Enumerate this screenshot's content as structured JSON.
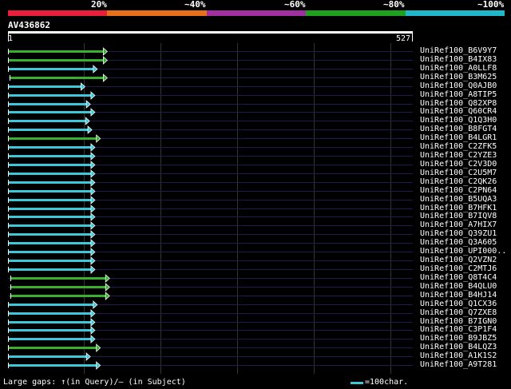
{
  "identity_scale": [
    {
      "label": "20%",
      "color": "#e8203a"
    },
    {
      "label": "~40%",
      "color": "#e8701a"
    },
    {
      "label": "~60%",
      "color": "#a030a0"
    },
    {
      "label": "~80%",
      "color": "#20a020"
    },
    {
      "label": "~100%",
      "color": "#20b8c8"
    }
  ],
  "query": {
    "id": "AV436862",
    "start": "1",
    "end": "527"
  },
  "colors": {
    "green": "#3ab030",
    "cyan": "#3cc8d8",
    "grid": "#333333",
    "row_line": "#1c1c50"
  },
  "hits": [
    {
      "id": "UniRef100_B6V9Y7",
      "color": "green",
      "start": 1,
      "end": 130
    },
    {
      "id": "UniRef100_B4IX83",
      "color": "green",
      "start": 1,
      "end": 130
    },
    {
      "id": "UniRef100_A0LLF8",
      "color": "cyan",
      "start": 1,
      "end": 117
    },
    {
      "id": "UniRef100_B3M625",
      "color": "green",
      "start": 3,
      "end": 130
    },
    {
      "id": "UniRef100_Q0AJB0",
      "color": "cyan",
      "start": 1,
      "end": 101
    },
    {
      "id": "UniRef100_A8TIP5",
      "color": "cyan",
      "start": 1,
      "end": 114
    },
    {
      "id": "UniRef100_Q82XP8",
      "color": "cyan",
      "start": 1,
      "end": 108
    },
    {
      "id": "UniRef100_Q60CR4",
      "color": "cyan",
      "start": 1,
      "end": 114
    },
    {
      "id": "UniRef100_Q1Q3H0",
      "color": "cyan",
      "start": 1,
      "end": 107
    },
    {
      "id": "UniRef100_B8FGT4",
      "color": "cyan",
      "start": 1,
      "end": 110
    },
    {
      "id": "UniRef100_B4LGR1",
      "color": "green",
      "start": 1,
      "end": 121
    },
    {
      "id": "UniRef100_C2ZFK5",
      "color": "cyan",
      "start": 1,
      "end": 114
    },
    {
      "id": "UniRef100_C2YZE3",
      "color": "cyan",
      "start": 1,
      "end": 114
    },
    {
      "id": "UniRef100_C2V3D0",
      "color": "cyan",
      "start": 1,
      "end": 114
    },
    {
      "id": "UniRef100_C2U5M7",
      "color": "cyan",
      "start": 1,
      "end": 114
    },
    {
      "id": "UniRef100_C2QK26",
      "color": "cyan",
      "start": 1,
      "end": 114
    },
    {
      "id": "UniRef100_C2PN64",
      "color": "cyan",
      "start": 1,
      "end": 114
    },
    {
      "id": "UniRef100_B5UQA3",
      "color": "cyan",
      "start": 1,
      "end": 114
    },
    {
      "id": "UniRef100_B7HFK1",
      "color": "cyan",
      "start": 1,
      "end": 114
    },
    {
      "id": "UniRef100_B7IQV8",
      "color": "cyan",
      "start": 1,
      "end": 114
    },
    {
      "id": "UniRef100_A7HIX7",
      "color": "cyan",
      "start": 1,
      "end": 114
    },
    {
      "id": "UniRef100_Q39ZU1",
      "color": "cyan",
      "start": 1,
      "end": 114
    },
    {
      "id": "UniRef100_Q3A605",
      "color": "cyan",
      "start": 1,
      "end": 114
    },
    {
      "id": "UniRef100_UPI000..",
      "color": "cyan",
      "start": 1,
      "end": 114
    },
    {
      "id": "UniRef100_Q2VZN2",
      "color": "cyan",
      "start": 1,
      "end": 114
    },
    {
      "id": "UniRef100_C2MTJ6",
      "color": "cyan",
      "start": 1,
      "end": 114
    },
    {
      "id": "UniRef100_Q8T4C4",
      "color": "green",
      "start": 4,
      "end": 133
    },
    {
      "id": "UniRef100_B4QLU0",
      "color": "green",
      "start": 4,
      "end": 133
    },
    {
      "id": "UniRef100_B4HJ14",
      "color": "green",
      "start": 4,
      "end": 133
    },
    {
      "id": "UniRef100_Q1CX36",
      "color": "cyan",
      "start": 1,
      "end": 117
    },
    {
      "id": "UniRef100_Q7ZXE8",
      "color": "cyan",
      "start": 1,
      "end": 114
    },
    {
      "id": "UniRef100_B7IGN0",
      "color": "cyan",
      "start": 1,
      "end": 114
    },
    {
      "id": "UniRef100_C3P1F4",
      "color": "cyan",
      "start": 1,
      "end": 114
    },
    {
      "id": "UniRef100_B9JBZ5",
      "color": "cyan",
      "start": 1,
      "end": 114
    },
    {
      "id": "UniRef100_B4LQZ3",
      "color": "green",
      "start": 1,
      "end": 121
    },
    {
      "id": "UniRef100_A1K1S2",
      "color": "cyan",
      "start": 1,
      "end": 108
    },
    {
      "id": "UniRef100_A9T281",
      "color": "cyan",
      "start": 1,
      "end": 121
    }
  ],
  "footer": {
    "gaps_text": "Large gaps: ↑(in Query)/– (in Subject)",
    "legend_text": "=100char."
  }
}
